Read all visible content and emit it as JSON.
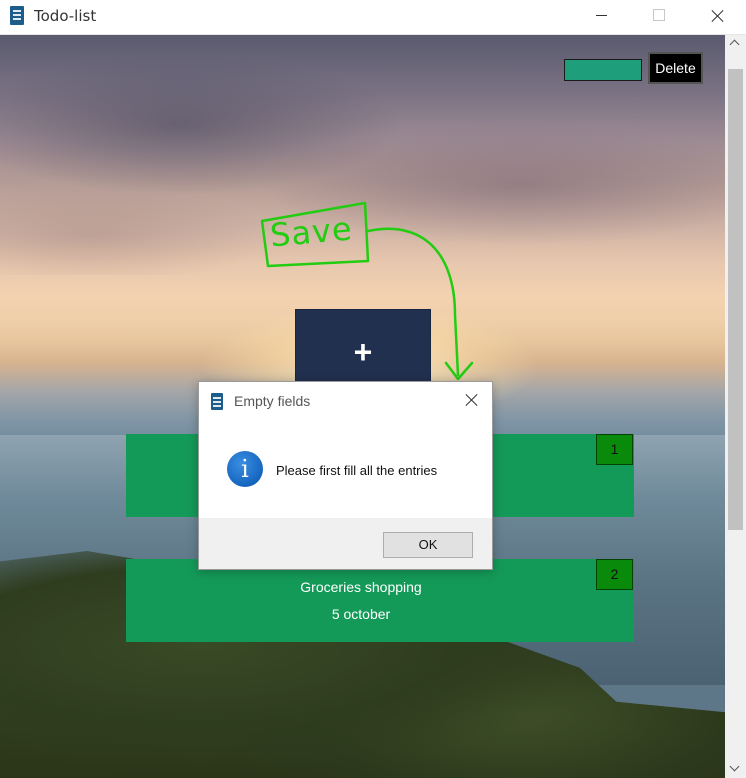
{
  "window": {
    "title": "Todo-list"
  },
  "toolbar": {
    "delete_input_value": "",
    "delete_label": "Delete"
  },
  "add_button": {
    "label": "+"
  },
  "annotation": {
    "text": "Save"
  },
  "todos": [
    {
      "number": "1",
      "title": "",
      "date": ""
    },
    {
      "number": "2",
      "title": "Groceries shopping",
      "date": "5 october"
    }
  ],
  "dialog": {
    "title": "Empty fields",
    "message": "Please first fill all the entries",
    "ok_label": "OK"
  },
  "colors": {
    "card": "#149a58",
    "card_number": "#0a8a0a",
    "add_button": "#22304f",
    "delete_input": "#1f9e7c",
    "annotation": "#22cc11"
  }
}
